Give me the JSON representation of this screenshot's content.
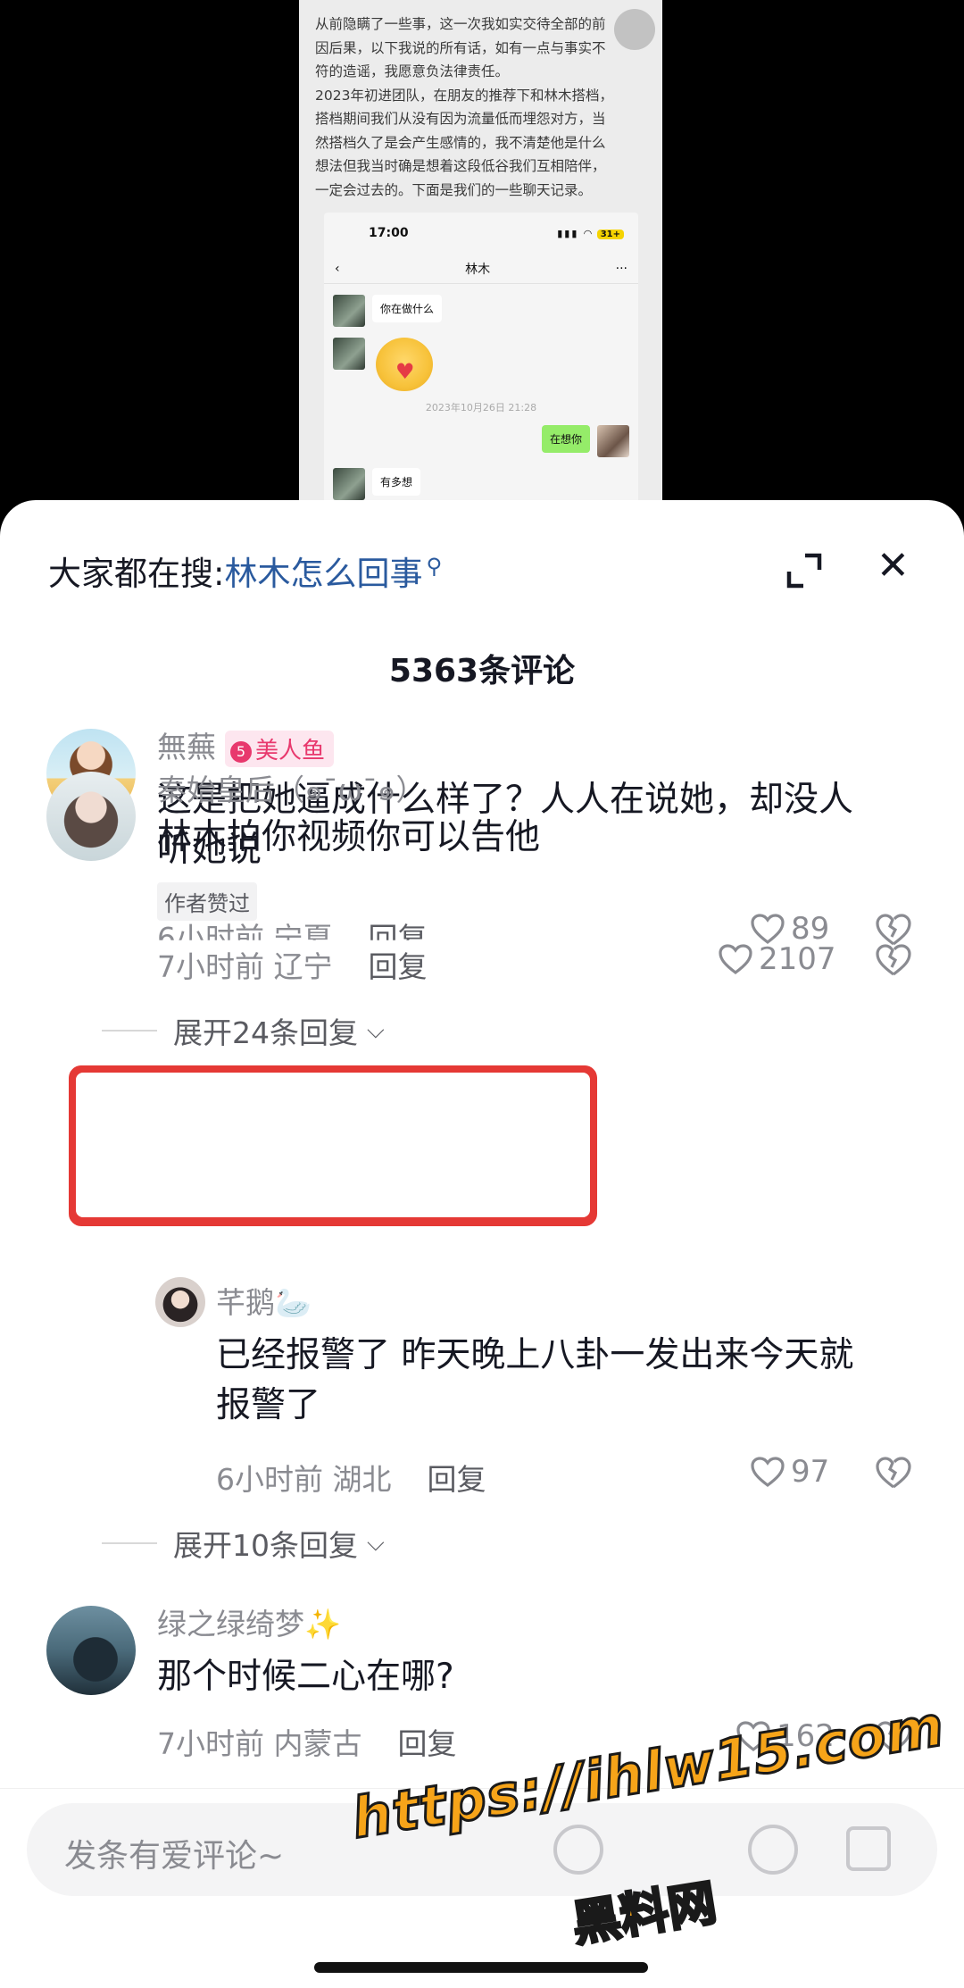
{
  "video": {
    "doc_lines": [
      "从前隐瞒了一些事，这一次我如实交待全部的前",
      "因后果，以下我说的所有话，如有一点与事实不",
      "符的造谣，我愿意负法律责任。",
      "2023年初进团队，在朋友的推荐下和林木搭档，",
      "搭档期间我们从没有因为流量低而埋怨对方，当",
      "然搭档久了是会产生感情的，我不清楚他是什么",
      "想法但我当时确是想着这段低谷我们互相陪伴，",
      "一定会过去的。下面是我们的一些聊天记录。"
    ],
    "phone": {
      "time": "17:00",
      "battery": "31+",
      "chat_title": "林木",
      "back": "‹",
      "more": "···",
      "msg1": "你在做什么",
      "timestamp": "2023年10月26日 21:28",
      "msg_me": "在想你",
      "msg3": "有多想"
    }
  },
  "sheet": {
    "search_prefix": "大家都在搜:",
    "search_term": "林木怎么回事",
    "comment_count": "5363条评论",
    "input_placeholder": "发条有爱评论~"
  },
  "comments": [
    {
      "user": "無蕪",
      "badge_level": "5",
      "badge_text": "美人鱼",
      "text_line1": "这是把她逼成什么样了？人人在说她，却没人",
      "text_line2": "听她说",
      "author_liked": "作者赞过",
      "time_loc": "7小时前 辽宁",
      "reply": "回复",
      "likes": "2107",
      "expand": "展开24条回复"
    },
    {
      "user": "秦始皇后（๑¯ω¯๑）",
      "text": "林木拍你视频你可以告他",
      "time_loc": "6小时前 宁夏",
      "reply": "回复",
      "likes": "89"
    },
    {
      "user": "芊鹅🦢",
      "text_line1": "已经报警了 昨天晚上八卦一发出来今天就",
      "text_line2": "报警了",
      "time_loc": "6小时前 湖北",
      "reply": "回复",
      "likes": "97",
      "expand": "展开10条回复"
    },
    {
      "user": "绿之绿绮梦✨",
      "text": "那个时候二心在哪?",
      "time_loc": "7小时前 内蒙古",
      "reply": "回复",
      "likes": "162"
    }
  ],
  "watermark": {
    "url": "https://ihlw15.com",
    "label": "黑料网"
  },
  "colors": {
    "accent_blue": "#2a5a9e",
    "highlight_red": "#e53935",
    "badge_pink": "#e8386d",
    "watermark_orange": "#f6a419"
  }
}
